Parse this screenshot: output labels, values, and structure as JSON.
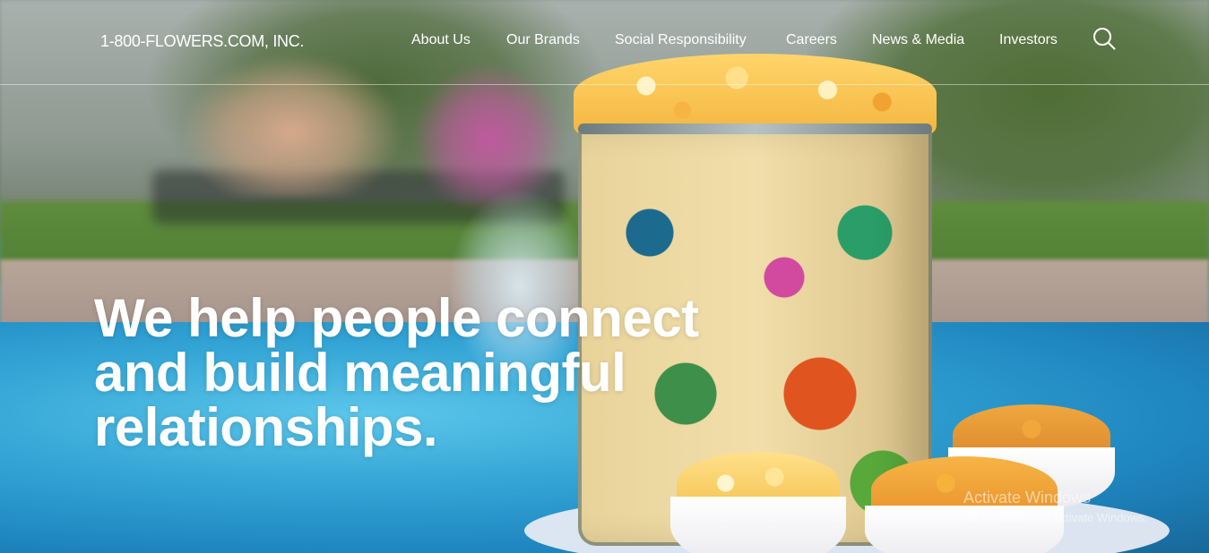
{
  "header": {
    "logo": "1-800-FLOWERS.COM, INC.",
    "nav": [
      {
        "label": "About Us"
      },
      {
        "label": "Our Brands"
      },
      {
        "label": "Social Responsibility"
      },
      {
        "label": "Careers"
      },
      {
        "label": "News & Media"
      },
      {
        "label": "Investors"
      }
    ],
    "search_icon": "search-icon"
  },
  "hero": {
    "headline_line1": "We help people connect",
    "headline_line2": "and build meaningful",
    "headline_line3": "relationships."
  },
  "watermark": {
    "title": "Activate Windows",
    "subtitle": "Go to Settings to activate Windows."
  }
}
